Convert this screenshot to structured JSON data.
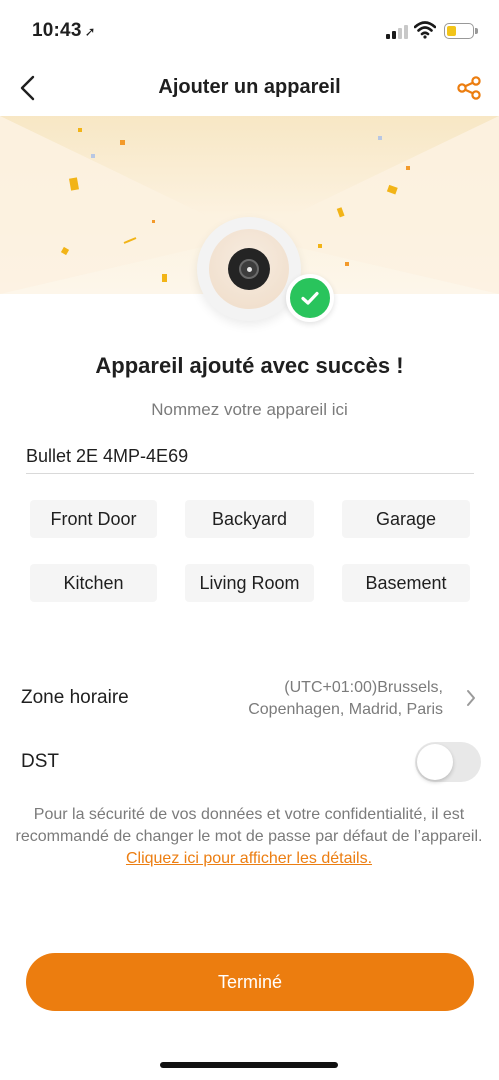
{
  "status_bar": {
    "time": "10:43",
    "location_icon": "location-arrow-icon",
    "signal_icon": "signal-icon",
    "wifi_icon": "wifi-icon",
    "battery_icon": "battery-icon",
    "battery_level": 0.38,
    "battery_color": "#f2c41a"
  },
  "nav": {
    "back_icon": "chevron-left-icon",
    "title": "Ajouter un appareil",
    "share_icon": "share-icon"
  },
  "hero": {
    "device_icon": "camera-lens-icon",
    "badge_icon": "check-icon"
  },
  "success": {
    "title": "Appareil ajouté avec succès !",
    "hint": "Nommez votre appareil ici"
  },
  "device_name": {
    "value": "Bullet 2E 4MP-4E69"
  },
  "suggestions": [
    "Front Door",
    "Backyard",
    "Garage",
    "Kitchen",
    "Living Room",
    "Basement"
  ],
  "timezone": {
    "label": "Zone horaire",
    "value_line1": "(UTC+01:00)Brussels,",
    "value_line2": "Copenhagen, Madrid, Paris",
    "chevron_icon": "chevron-right-icon"
  },
  "dst": {
    "label": "DST",
    "enabled": false
  },
  "notice": {
    "text": "Pour la sécurité de vos données et votre confidentialité, il est recommandé de changer le mot de passe par défaut de l’appareil. ",
    "link": "Cliquez ici pour afficher les détails."
  },
  "done_button": {
    "label": "Terminé"
  },
  "colors": {
    "accent": "#ec7d0f",
    "success": "#29c45c",
    "text": "#1f1f1f",
    "muted": "#7b7b7b"
  }
}
